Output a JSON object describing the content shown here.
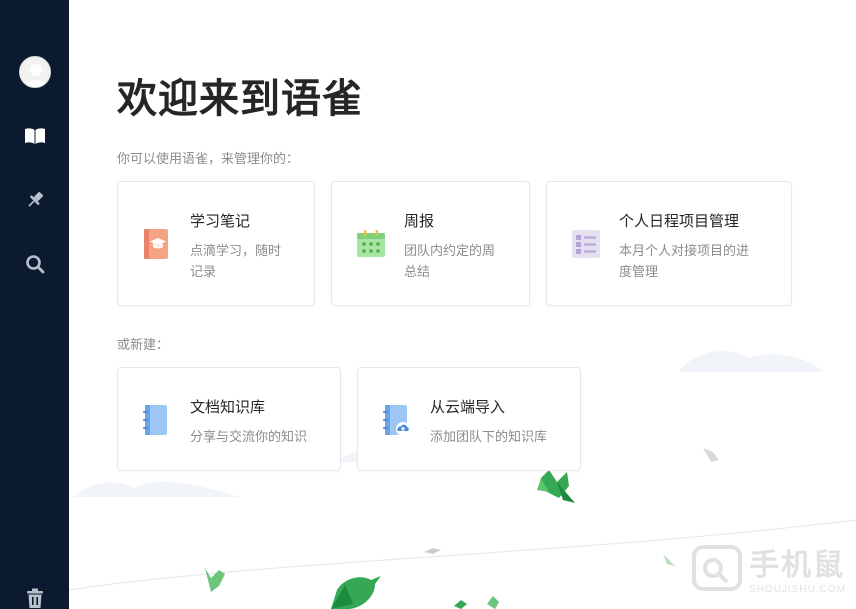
{
  "sidebar": {
    "items": [
      {
        "icon": "avatar"
      },
      {
        "icon": "book-icon"
      },
      {
        "icon": "pin-icon"
      },
      {
        "icon": "search-icon"
      },
      {
        "icon": "trash-icon"
      }
    ]
  },
  "main": {
    "title": "欢迎来到语雀",
    "subtitle": "你可以使用语雀，来管理你的：",
    "manage_cards": [
      {
        "title": "学习笔记",
        "desc_line1": "点滴学习，随时",
        "desc_line2": "记录",
        "icon": "study-notes-icon",
        "color": "#f4a384"
      },
      {
        "title": "周报",
        "desc_line1": "团队内约定的周",
        "desc_line2": "总结",
        "icon": "calendar-icon",
        "color": "#8fd88a"
      },
      {
        "title": "个人日程项目管理",
        "desc_line1": "本月个人对接项目的进",
        "desc_line2": "度管理",
        "icon": "checklist-icon",
        "color": "#b7a4d6"
      }
    ],
    "new_label": "或新建：",
    "new_cards": [
      {
        "title": "文档知识库",
        "desc": "分享与交流你的知识",
        "icon": "notebook-icon",
        "color": "#7fb5f0"
      },
      {
        "title": "从云端导入",
        "desc": "添加团队下的知识库",
        "icon": "cloud-import-icon",
        "color": "#7fb5f0"
      }
    ]
  },
  "watermark": {
    "text": "手机鼠",
    "sub": "SHOUJISHU.COM"
  }
}
